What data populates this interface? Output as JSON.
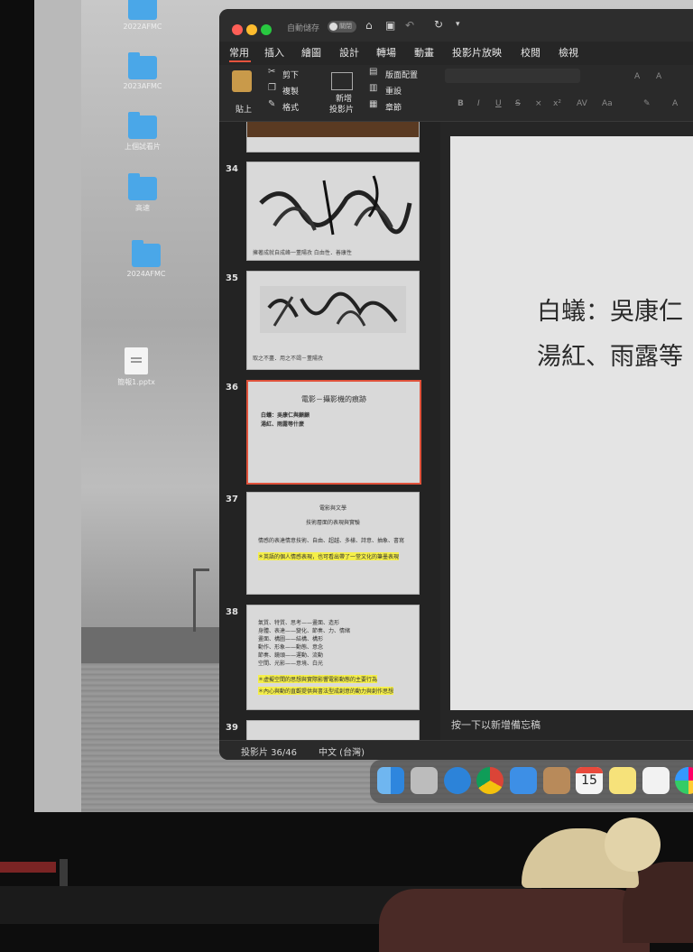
{
  "desktop": {
    "icons": [
      {
        "label": "2022AFMC",
        "type": "folder"
      },
      {
        "label": "2023AFMC",
        "type": "folder"
      },
      {
        "label": "上個試看片",
        "type": "folder"
      },
      {
        "label": "高速",
        "type": "folder"
      },
      {
        "label": "2024AFMC",
        "type": "folder"
      },
      {
        "label": "簡報1.pptx",
        "type": "file"
      }
    ]
  },
  "titlebar": {
    "autosave_label": "自動儲存",
    "autosave_state": "關閉",
    "colors": {
      "close": "#ff5f57",
      "minimize": "#febc2e",
      "zoom": "#28c840"
    }
  },
  "ribbon_tabs": [
    "常用",
    "插入",
    "繪圖",
    "設計",
    "轉場",
    "動畫",
    "投影片放映",
    "校閱",
    "檢視"
  ],
  "ribbon": {
    "paste": "貼上",
    "cut": "剪下",
    "copy": "複製",
    "format": "格式",
    "new_slide_l1": "新增",
    "new_slide_l2": "投影片",
    "layout": "版面配置",
    "reset": "重設",
    "section": "章節"
  },
  "thumbnails": [
    {
      "number": "34",
      "caption": "擁著成就自成峰一董陽孜      白由性．善康性"
    },
    {
      "number": "35",
      "caption": "取之不盡．用之不竭－董陽孜"
    },
    {
      "number": "36",
      "title": "電影－攝影機的痕跡",
      "lines": [
        "白蟻：吳康仁與顧顧",
        "湯紅、雨露等什麼"
      ]
    },
    {
      "number": "37",
      "title": "電影與文學",
      "subtitle": "技術層面的表現與實驗",
      "body": "情感的表達情意技術、自由、超越、多樣、詩意、抽象、書寫",
      "highlight": "＊英語的個人情感表現，也可看出帶了一堂文化的筆墨表現"
    },
    {
      "number": "38",
      "lines": [
        "氣質、特質、思考——畫面、造形",
        "身體、表達——變化、節奏、力、情緒",
        "畫面、構圖——結構、構形",
        "動作、形象——動態、意念",
        "節奏、鏡頭——運動、流動",
        "空間、光影——意境、白光"
      ],
      "highlights": [
        "＊虛擬空間的思想與實際影響電影動態的主要行為",
        "＊內心與動的直觀提供與書法型成創意的動力與創作思想"
      ]
    },
    {
      "number": "39"
    }
  ],
  "slide": {
    "line1": "白蟻：吳康仁",
    "line2": "湯紅、雨露等"
  },
  "notes_placeholder": "按一下以新增備忘稿",
  "status": {
    "slide_counter": "投影片 36/46",
    "language": "中文 (台灣)"
  },
  "dock": {
    "calendar_day": "15",
    "apps": [
      "finder-icon",
      "launchpad-icon",
      "safari-icon",
      "chrome-icon",
      "mail-icon",
      "contacts-icon",
      "calendar-icon",
      "notes-icon",
      "reminders-icon",
      "photos-icon"
    ]
  }
}
